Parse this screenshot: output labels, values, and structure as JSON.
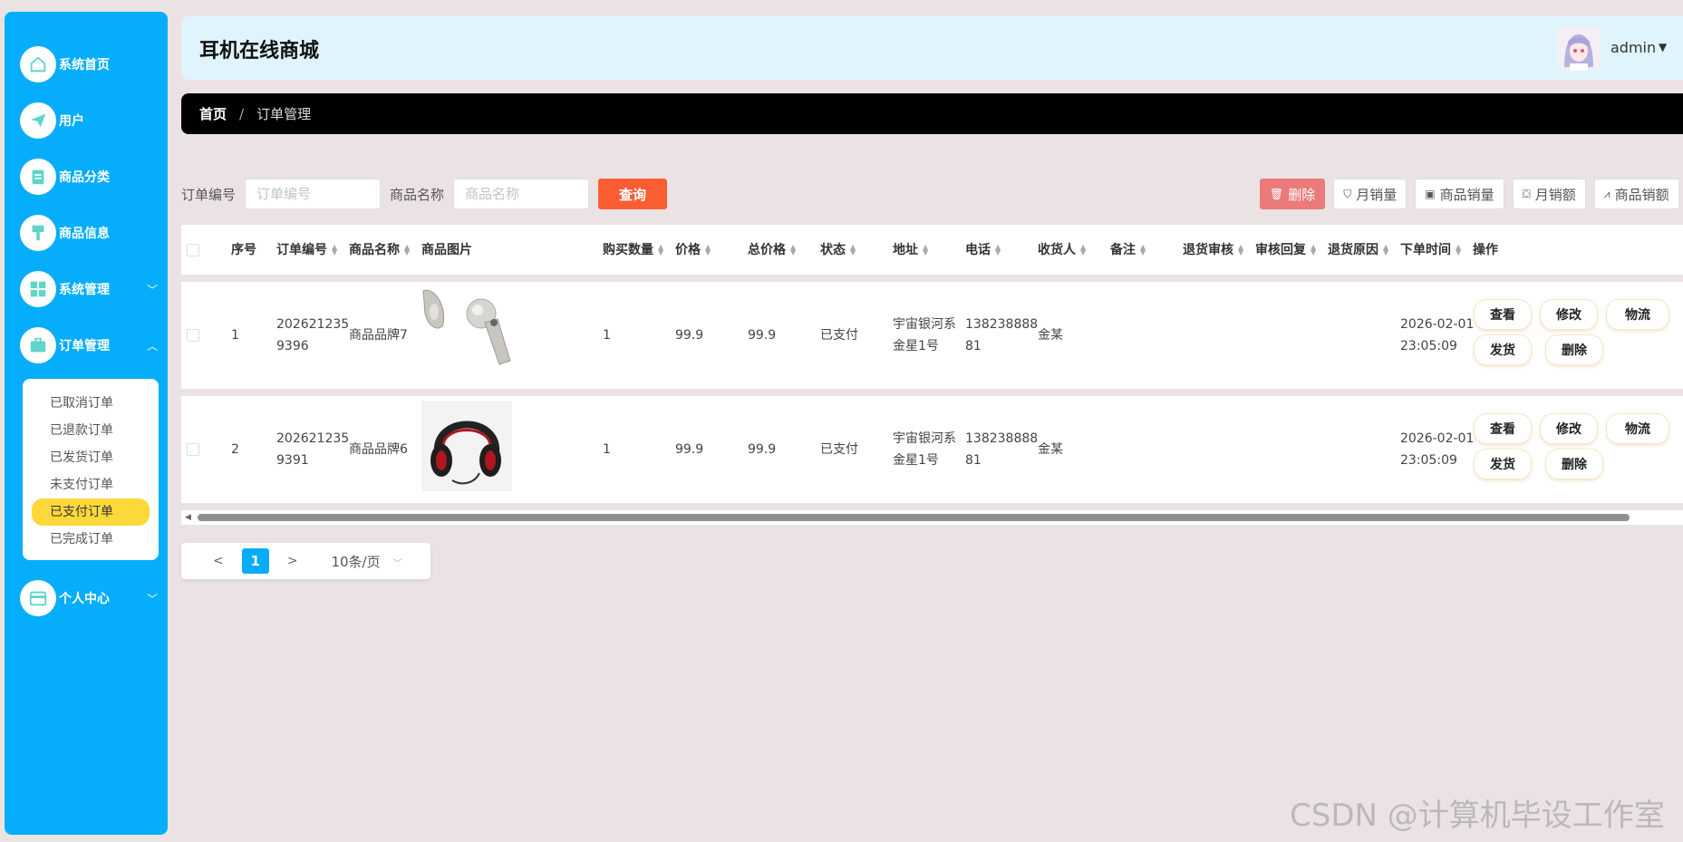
{
  "sidebar": {
    "items": [
      {
        "label": "系统首页",
        "icon": "home-icon"
      },
      {
        "label": "用户",
        "icon": "paper-plane-icon"
      },
      {
        "label": "商品分类",
        "icon": "clipboard-icon"
      },
      {
        "label": "商品信息",
        "icon": "brush-icon"
      },
      {
        "label": "系统管理",
        "icon": "grid-icon"
      },
      {
        "label": "订单管理",
        "icon": "briefcase-icon"
      },
      {
        "label": "个人中心",
        "icon": "wallet-icon"
      }
    ],
    "submenu": [
      "已取消订单",
      "已退款订单",
      "已发货订单",
      "未支付订单",
      "已支付订单",
      "已完成订单"
    ],
    "active_sub": "已支付订单"
  },
  "header": {
    "title": "耳机在线商城",
    "user": "admin"
  },
  "breadcrumb": {
    "home": "首页",
    "separator": "/",
    "current": "订单管理"
  },
  "search": {
    "order_no_label": "订单编号",
    "order_no_placeholder": "订单编号",
    "product_label": "商品名称",
    "product_placeholder": "商品名称",
    "query_button": "查询"
  },
  "toolbar": {
    "delete": "删除",
    "monthly_sales": "月销量",
    "product_sales": "商品销量",
    "monthly_revenue": "月销额",
    "product_revenue": "商品销额"
  },
  "table": {
    "columns": [
      "序号",
      "订单编号",
      "商品名称",
      "商品图片",
      "购买数量",
      "价格",
      "总价格",
      "状态",
      "地址",
      "电话",
      "收货人",
      "备注",
      "退货审核",
      "审核回复",
      "退货原因",
      "下单时间",
      "操作"
    ],
    "rows": [
      {
        "index": "1",
        "order_no_1": "202621235",
        "order_no_2": "9396",
        "product": "商品品牌7",
        "image": "earbuds",
        "qty": "1",
        "price": "99.9",
        "total": "99.9",
        "status": "已支付",
        "address_1": "宇宙银河系",
        "address_2": "金星1号",
        "phone_1": "138238888",
        "phone_2": "81",
        "receiver": "金某",
        "date": "2026-02-01",
        "time": "23:05:09"
      },
      {
        "index": "2",
        "order_no_1": "202621235",
        "order_no_2": "9391",
        "product": "商品品牌6",
        "image": "headphones",
        "qty": "1",
        "price": "99.9",
        "total": "99.9",
        "status": "已支付",
        "address_1": "宇宙银河系",
        "address_2": "金星1号",
        "phone_1": "138238888",
        "phone_2": "81",
        "receiver": "金某",
        "date": "2026-02-01",
        "time": "23:05:09"
      }
    ],
    "actions": {
      "view": "查看",
      "edit": "修改",
      "logistics": "物流",
      "ship": "发货",
      "delete": "删除"
    }
  },
  "pagination": {
    "prev": "<",
    "current": "1",
    "next": ">",
    "page_size": "10条/页"
  },
  "watermark": "CSDN @计算机毕设工作室",
  "colors": {
    "sidebar": "#06adfb",
    "header": "#e0f4fd",
    "query": "#fb5d33",
    "active_sub": "#fdd83a",
    "delete": "#eb7a7a"
  }
}
